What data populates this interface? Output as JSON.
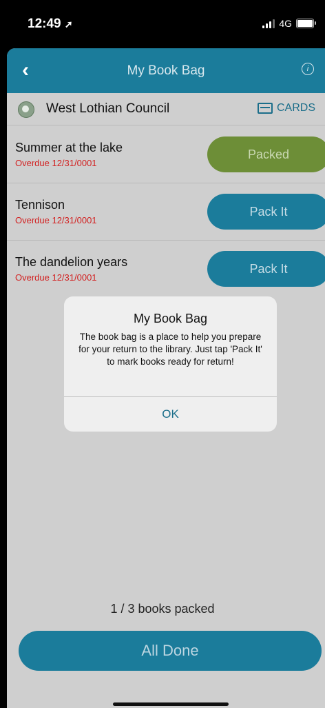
{
  "status": {
    "time": "12:49",
    "carrier_network": "4G"
  },
  "header": {
    "title": "My Book Bag"
  },
  "library": {
    "name": "West Lothian Council",
    "cards_label": "CARDS"
  },
  "books": [
    {
      "title": "Summer at the lake",
      "due": "Overdue 12/31/0001",
      "action": "Packed",
      "packed": true
    },
    {
      "title": "Tennison",
      "due": "Overdue 12/31/0001",
      "action": "Pack It",
      "packed": false
    },
    {
      "title": "The dandelion years",
      "due": "Overdue 12/31/0001",
      "action": "Pack It",
      "packed": false
    }
  ],
  "footer": {
    "count": "1 / 3 books packed",
    "done_label": "All Done"
  },
  "dialog": {
    "title": "My Book Bag",
    "message": "The book bag is a place to help you prepare for your return to the library. Just tap 'Pack It' to mark books ready for return!",
    "ok_label": "OK"
  },
  "colors": {
    "accent": "#1b7c9b",
    "packed": "#6d8e37",
    "overdue": "#d21f1f"
  }
}
